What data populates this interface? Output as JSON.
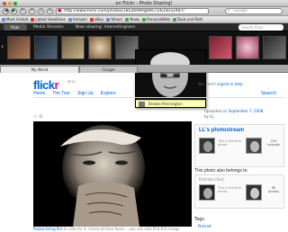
{
  "window": {
    "title": "on Flickr - Photo Sharing!"
  },
  "navbar": {
    "url": "http://www.flickr.com/photos/18536990@N07/2635032487/",
    "search_placeholder": "Google",
    "back_label": "◀",
    "forward_label": "▶",
    "reload_label": "↻",
    "add_label": "+"
  },
  "bookmarks": [
    "Most Visited",
    "Latest Headlines",
    "Amazon",
    "eBay",
    "Yahoo!",
    "News",
    "PersonalWeb",
    "Tools and Refs"
  ],
  "flickr_toolbar": {
    "logo": "flickr",
    "media_streams": "Media Streams",
    "now_viewing": "Now viewing: Interestingness",
    "search_placeholder": "Search flickr"
  },
  "tabs": [
    "My World",
    "Google"
  ],
  "page": {
    "logo_f": "flick",
    "logo_r": "r",
    "beta": "BETA",
    "nav": [
      "Home",
      "The Tour",
      "Sign Up",
      "Explore"
    ],
    "signin_prefix": "You aren't",
    "signin_link": "signed in",
    "signin_suffix": "Help",
    "search_link": "Search"
  },
  "photo": {
    "tools": "☆ ⊙",
    "caption_link": "Please bring fire",
    "caption_rest": "to vote for it, check all time faves... you can now find this image"
  },
  "sidebar": {
    "uploaded_prefix": "Uploaded on",
    "uploaded_date": "September 7, 2008",
    "uploaded_by_prefix": "by",
    "uploaded_by": "LL",
    "stream_title": "LL's photostream",
    "stream_count": "294",
    "stream_count_label": "uploads",
    "stream_mini_label": "This is the first photo.",
    "belongs_title": "This photo also belongs to:",
    "set_name": "Portraits (Set)",
    "set_count": "86",
    "set_count_label": "photos",
    "set_mini_label": "This is the first photo.",
    "tags_title": "Tags",
    "tag1": "Portrait"
  },
  "popup": {
    "name": "Brooke Pennington"
  },
  "colors": {
    "flickr_blue": "#0063dc",
    "flickr_pink": "#ff0084"
  }
}
